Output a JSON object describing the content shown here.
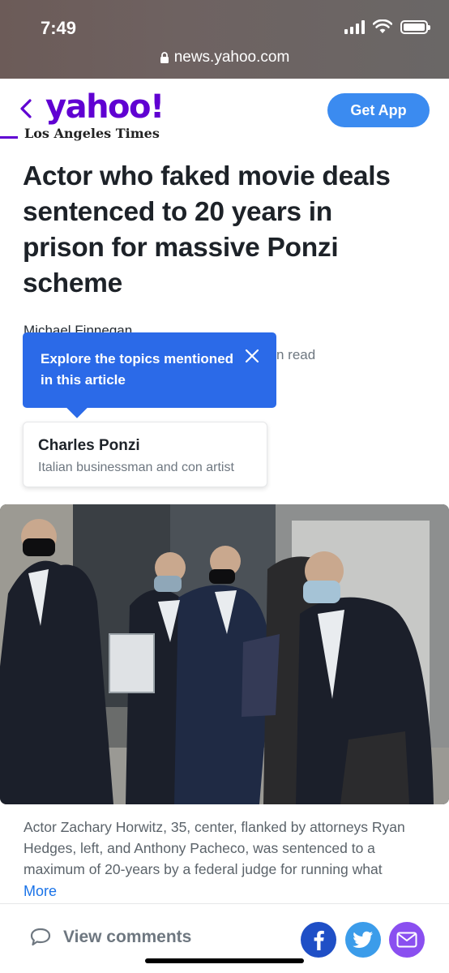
{
  "status_bar": {
    "time": "7:49",
    "url": "news.yahoo.com"
  },
  "header": {
    "logo": "yahoo!",
    "get_app_label": "Get App"
  },
  "article": {
    "source": "Los Angeles Times",
    "headline": "Actor who faked movie deals sentenced to 20 years in prison for massive Ponzi scheme",
    "author": "Michael Finnegan",
    "read_time_fragment": "n read"
  },
  "tooltip": {
    "text": "Explore the topics mentioned in this article"
  },
  "topic": {
    "name": "Charles Ponzi",
    "description": "Italian businessman and con artist"
  },
  "photo": {
    "caption": "Actor Zachary Horwitz, 35, center, flanked by attorneys Ryan Hedges, left, and Anthony Pacheco, was sentenced to a maximum of 20-years by a federal judge for running what",
    "more_label": "More"
  },
  "bottom_bar": {
    "comments_label": "View comments"
  },
  "colors": {
    "yahoo_purple": "#6001d2",
    "get_app_blue": "#3b8bf0",
    "tooltip_blue": "#2b6ae8",
    "facebook": "#1f4fc6",
    "twitter": "#3b9cea",
    "mail": "#8a4ff0"
  }
}
